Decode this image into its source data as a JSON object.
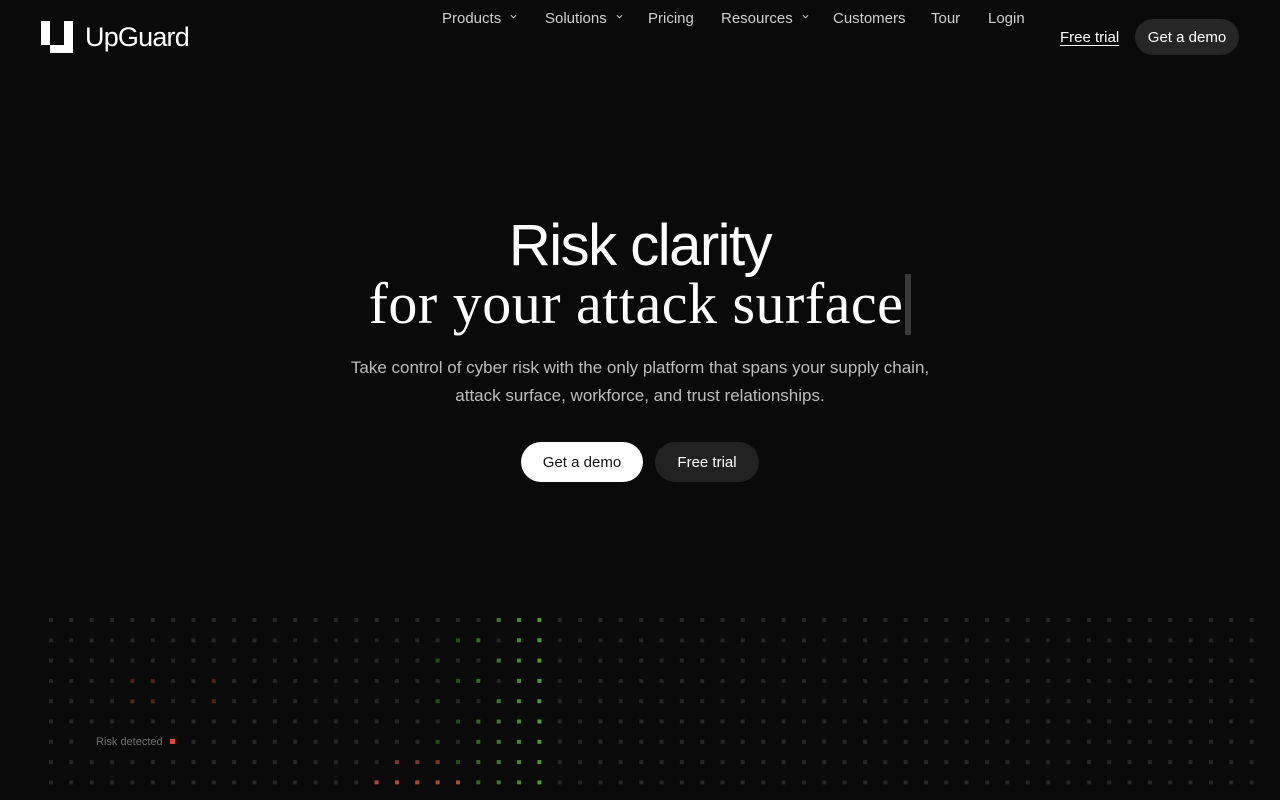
{
  "brand": {
    "name": "UpGuard"
  },
  "nav": {
    "items": [
      {
        "label": "Products",
        "has_dropdown": true
      },
      {
        "label": "Solutions",
        "has_dropdown": true
      },
      {
        "label": "Pricing",
        "has_dropdown": false
      },
      {
        "label": "Resources",
        "has_dropdown": true
      },
      {
        "label": "Customers",
        "has_dropdown": false
      },
      {
        "label": "Tour",
        "has_dropdown": false
      },
      {
        "label": "Login",
        "has_dropdown": false
      }
    ],
    "free_trial_label": "Free trial",
    "demo_label": "Get a demo"
  },
  "hero": {
    "title": "Risk clarity",
    "subtitle": "for your attack surface",
    "description": "Take control of cyber risk with the only platform that spans your supply chain, attack surface, workforce, and trust relationships.",
    "primary_cta": "Get a demo",
    "secondary_cta": "Free trial"
  },
  "visual": {
    "risk_label": "Risk detected"
  },
  "colors": {
    "background": "#0a0a0a",
    "dot_base": "#262626",
    "dot_green": "#4f9a3a",
    "dot_red": "#c8553d",
    "risk_accent": "#e0483d"
  },
  "icons": {
    "logo": "upguard-logo-icon",
    "dropdown": "chevron-down-icon"
  }
}
